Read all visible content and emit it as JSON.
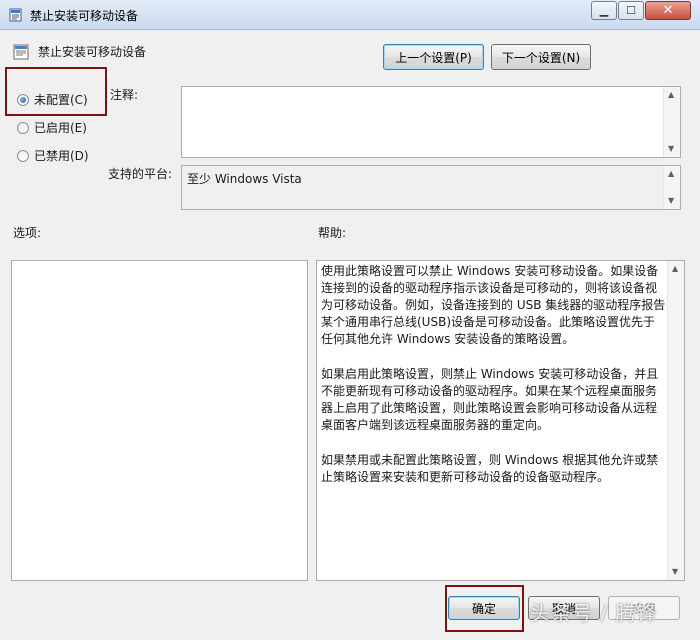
{
  "window": {
    "title": "禁止安装可移动设备",
    "title_icon": "policy-window-icon"
  },
  "header": {
    "policy_title": "禁止安装可移动设备",
    "prev_setting": "上一个设置(P)",
    "next_setting": "下一个设置(N)"
  },
  "state": {
    "options": [
      {
        "label": "未配置(C)",
        "checked": true
      },
      {
        "label": "已启用(E)",
        "checked": false
      },
      {
        "label": "已禁用(D)",
        "checked": false
      }
    ]
  },
  "comment": {
    "label": "注释:",
    "value": ""
  },
  "platform": {
    "label": "支持的平台:",
    "value": "至少 Windows Vista"
  },
  "options_section": {
    "label": "选项:"
  },
  "help_section": {
    "label": "帮助:",
    "paragraphs": [
      "使用此策略设置可以禁止 Windows 安装可移动设备。如果设备连接到的设备的驱动程序指示该设备是可移动的，则将该设备视为可移动设备。例如，设备连接到的 USB 集线器的驱动程序报告某个通用串行总线(USB)设备是可移动设备。此策略设置优先于任何其他允许 Windows 安装设备的策略设置。",
      "如果启用此策略设置，则禁止 Windows 安装可移动设备，并且不能更新现有可移动设备的驱动程序。如果在某个远程桌面服务器上启用了此策略设置，则此策略设置会影响可移动设备从远程桌面客户端到该远程桌面服务器的重定向。",
      "如果禁用或未配置此策略设置，则 Windows 根据其他允许或禁止策略设置来安装和更新可移动设备的设备驱动程序。"
    ]
  },
  "footer": {
    "ok": "确定",
    "cancel": "取消",
    "apply": "应用"
  },
  "watermark": "头条号 / 腾锋",
  "colors": {
    "highlight_border": "#7a1414",
    "radio_checked": "#1f5ea8"
  }
}
